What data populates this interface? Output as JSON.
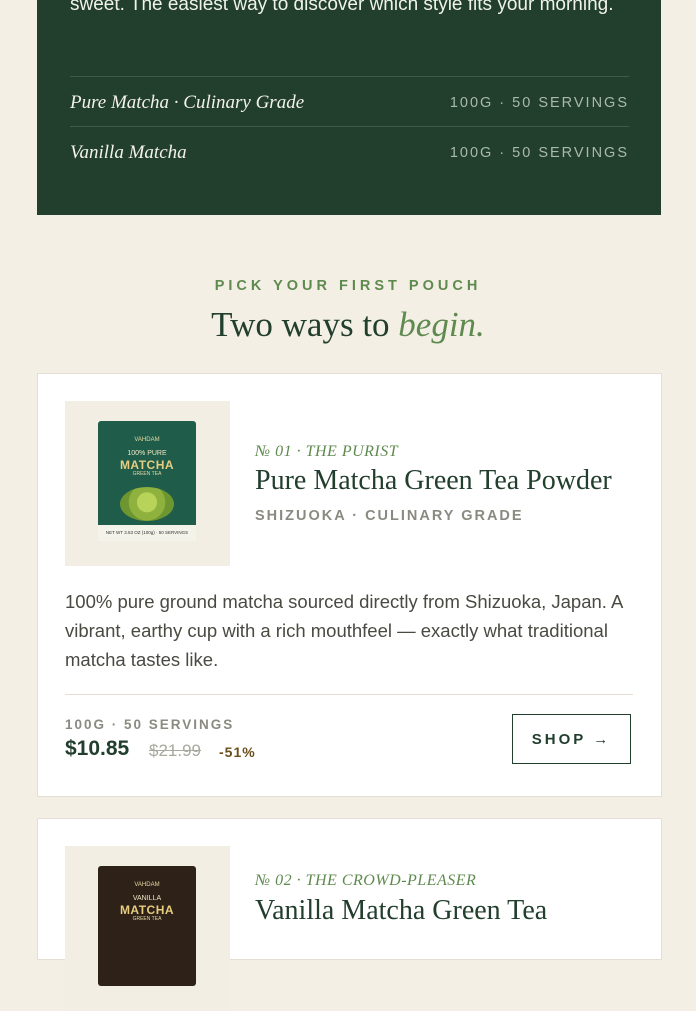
{
  "banner": {
    "text": "sweet. The easiest way to discover which style fits your morning.",
    "rows": [
      {
        "name": "Pure Matcha · Culinary Grade",
        "meta": "100G · 50 SERVINGS"
      },
      {
        "name": "Vanilla Matcha",
        "meta": "100G · 50 SERVINGS"
      }
    ]
  },
  "section": {
    "eyebrow": "PICK YOUR FIRST POUCH",
    "title_main": "Two ways to ",
    "title_accent": "begin."
  },
  "products": [
    {
      "kicker": "№ 01 · THE PURIST",
      "name": "Pure Matcha Green Tea Powder",
      "origin": "SHIZUOKA · CULINARY GRADE",
      "description": "100% pure ground matcha sourced directly from Shizuoka, Japan. A vibrant, earthy cup with a rich mouthfeel — exactly what traditional matcha tastes like.",
      "size": "100G · 50 SERVINGS",
      "price": "$10.85",
      "was_price": "$21.99",
      "discount": "-51%",
      "shop_label": "SHOP →",
      "pouch": {
        "brand": "VAHDAM",
        "line1": "100% PURE",
        "title": "MATCHA",
        "sub": "GREEN TEA",
        "bottom": "NET WT 3.53 OZ (100g) · 50 SERVINGS",
        "color": "#1f5d4a"
      }
    },
    {
      "kicker": "№ 02 · THE CROWD-PLEASER",
      "name": "Vanilla Matcha Green Tea",
      "pouch": {
        "brand": "VAHDAM",
        "line1": "VANILLA",
        "title": "MATCHA",
        "sub": "GREEN TEA",
        "color": "#2e2218"
      }
    }
  ]
}
